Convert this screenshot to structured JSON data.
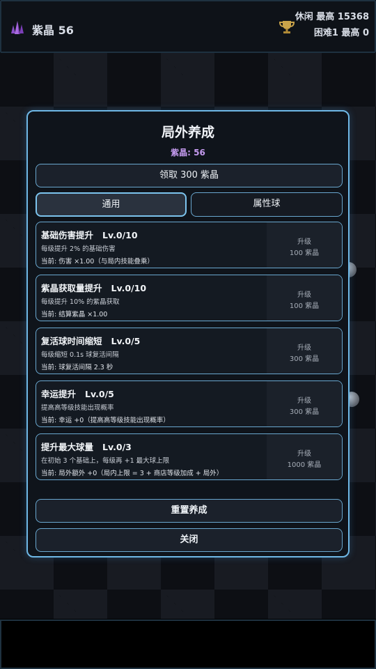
{
  "topbar": {
    "crystal_label": "紫晶 56",
    "best_casual": "休闲 最高 15368",
    "best_hard": "困难1 最高 0",
    "crystal_icon": "crystal-icon",
    "trophy_icon": "trophy-icon"
  },
  "modal": {
    "title": "局外养成",
    "crystal_count": "紫晶: 56",
    "claim_button": "领取 300 紫晶",
    "tabs": [
      {
        "label": "通用",
        "active": true
      },
      {
        "label": "属性球",
        "active": false
      }
    ],
    "upgrades": [
      {
        "title": "基础伤害提升   Lv.0/10",
        "desc": "每级提升 2% 的基础伤害",
        "current": "当前: 伤害 ×1.00（与局内技能叠乘）",
        "action": "升级",
        "cost": "100 紫晶"
      },
      {
        "title": "紫晶获取量提升   Lv.0/10",
        "desc": "每级提升 10% 的紫晶获取",
        "current": "当前: 结算紫晶 ×1.00",
        "action": "升级",
        "cost": "100 紫晶"
      },
      {
        "title": "复活球时间缩短   Lv.0/5",
        "desc": "每级缩短 0.1s 球复活间隔",
        "current": "当前: 球复活间隔 2.3 秒",
        "action": "升级",
        "cost": "300 紫晶"
      },
      {
        "title": "幸运提升   Lv.0/5",
        "desc": "提高高等级技能出现概率",
        "current": "当前: 幸运 +0（提高高等级技能出现概率）",
        "action": "升级",
        "cost": "300 紫晶"
      },
      {
        "title": "提升最大球量   Lv.0/3",
        "desc": "在初始 3 个基础上，每级再 +1 最大球上限",
        "current": "当前: 局外额外 +0（局内上限 = 3 + 商店等级加成 + 局外）",
        "action": "升级",
        "cost": "1000 紫晶"
      }
    ],
    "reset_button": "重置养成",
    "close_button": "关闭"
  },
  "colors": {
    "accent_border": "#6fb8e6",
    "crystal_purple": "#c59bf0",
    "panel_bg": "#0f141b"
  }
}
